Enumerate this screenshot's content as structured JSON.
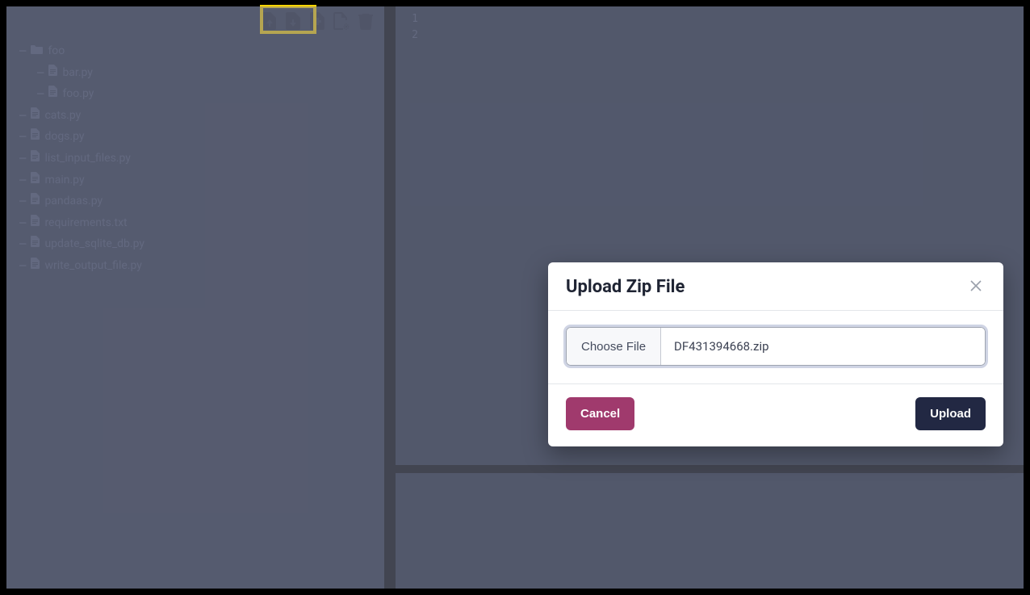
{
  "toolbar": {
    "upload_icon": "upload-file-icon",
    "download_icon": "download-file-icon",
    "new_file_icon": "new-file-icon",
    "add_file_icon": "add-file-icon",
    "delete_icon": "trash-icon"
  },
  "tree": {
    "folder": {
      "name": "foo"
    },
    "folder_children": [
      {
        "name": "bar.py"
      },
      {
        "name": "foo.py"
      }
    ],
    "files": [
      {
        "name": "cats.py"
      },
      {
        "name": "dogs.py"
      },
      {
        "name": "list_input_files.py"
      },
      {
        "name": "main.py"
      },
      {
        "name": "pandaas.py"
      },
      {
        "name": "requirements.txt"
      },
      {
        "name": "update_sqlite_db.py"
      },
      {
        "name": "write_output_file.py"
      }
    ]
  },
  "editor": {
    "line_numbers": [
      "1",
      "2"
    ]
  },
  "modal": {
    "title": "Upload Zip File",
    "choose_label": "Choose File",
    "selected_file": "DF431394668.zip",
    "cancel_label": "Cancel",
    "upload_label": "Upload"
  }
}
